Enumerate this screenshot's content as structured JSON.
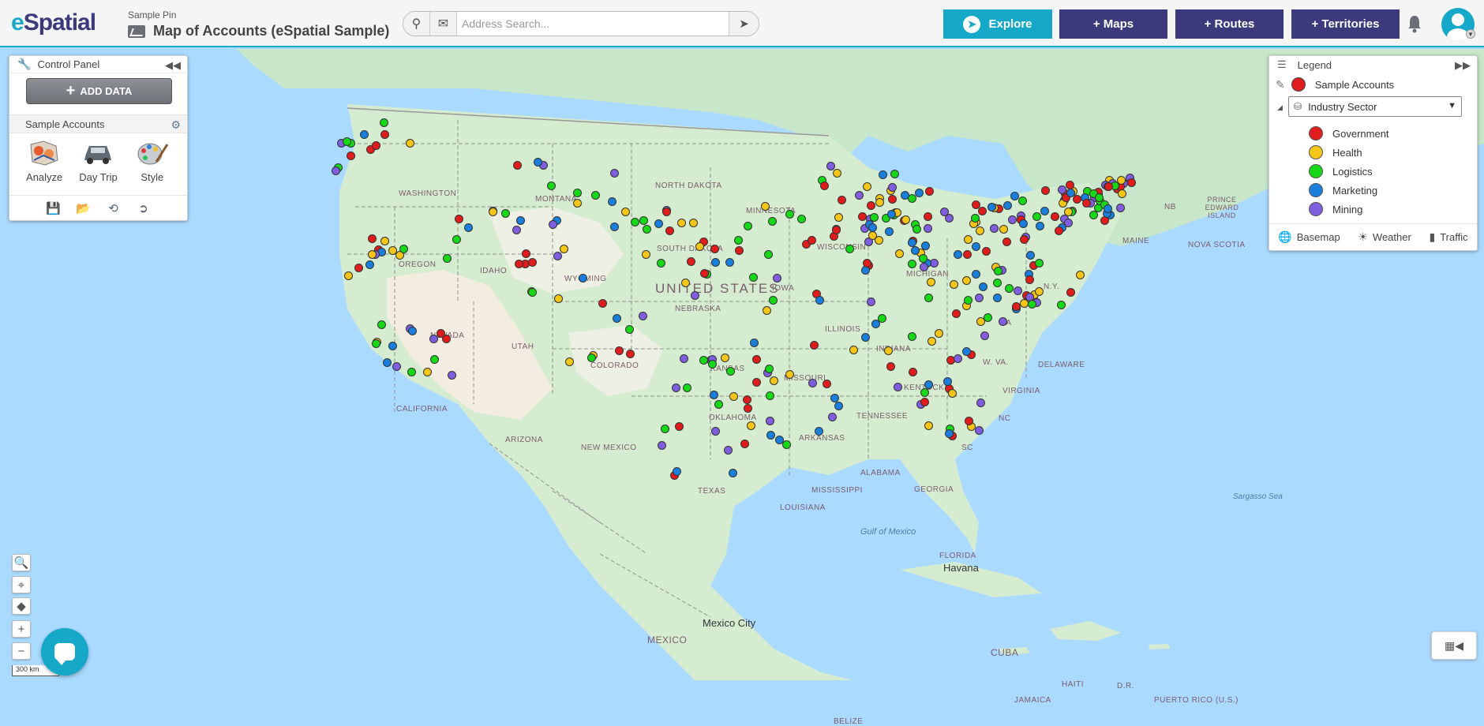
{
  "app": {
    "logo_e": "e",
    "logo_rest": "Spatial",
    "breadcrumb": "Sample Pin",
    "map_title": "Map of Accounts (eSpatial Sample)"
  },
  "search": {
    "placeholder": "Address Search..."
  },
  "nav": {
    "explore": "Explore",
    "maps": "+ Maps",
    "routes": "+ Routes",
    "territories": "+ Territories"
  },
  "control_panel": {
    "title": "Control Panel",
    "add_data": "ADD DATA",
    "layer_name": "Sample Accounts",
    "tools": [
      {
        "label": "Analyze",
        "icon": "analyze-icon"
      },
      {
        "label": "Day Trip",
        "icon": "car-icon"
      },
      {
        "label": "Style",
        "icon": "palette-icon"
      }
    ],
    "footer_icons": [
      "save-warning-icon",
      "folder-open-icon",
      "share-icon",
      "export-icon"
    ]
  },
  "legend": {
    "title": "Legend",
    "layer_name": "Sample Accounts",
    "group_by": "Industry Sector",
    "items": [
      {
        "label": "Government",
        "color": "#e01c1c"
      },
      {
        "label": "Health",
        "color": "#f5c518"
      },
      {
        "label": "Logistics",
        "color": "#16d816"
      },
      {
        "label": "Marketing",
        "color": "#1a7fdc"
      },
      {
        "label": "Mining",
        "color": "#7f5fe0"
      }
    ],
    "footer": {
      "basemap": "Basemap",
      "weather": "Weather",
      "traffic": "Traffic"
    }
  },
  "map": {
    "country": "UNITED STATES",
    "states": [
      "WASHINGTON",
      "OREGON",
      "IDAHO",
      "MONTANA",
      "NORTH DAKOTA",
      "SOUTH DAKOTA",
      "MINNESOTA",
      "WYOMING",
      "NEVADA",
      "UTAH",
      "COLORADO",
      "NEBRASKA",
      "IOWA",
      "WISCONSIN",
      "MICHIGAN",
      "ILLINOIS",
      "INDIANA",
      "CALIFORNIA",
      "KANSAS",
      "MISSOURI",
      "KENTUCKY",
      "OKLAHOMA",
      "ARIZONA",
      "NEW MEXICO",
      "ARKANSAS",
      "TENNESSEE",
      "TEXAS",
      "MISSISSIPPI",
      "ALABAMA",
      "GEORGIA",
      "LOUISIANA",
      "FLORIDA",
      "PA",
      "N.Y.",
      "MAINE",
      "W. VA.",
      "VIRGINIA",
      "SC",
      "NC",
      "DELAWARE",
      "NB",
      "NOVA SCOTIA",
      "PRINCE EDWARD ISLAND",
      "MEXICO",
      "CUBA",
      "HAITI",
      "D.R.",
      "JAMAICA",
      "PUERTO RICO (U.S.)",
      "BELIZE"
    ],
    "seas": [
      "Gulf of Mexico",
      "Sargasso Sea"
    ],
    "cities": [
      "Havana",
      "Mexico City"
    ],
    "scale": "300 km"
  }
}
